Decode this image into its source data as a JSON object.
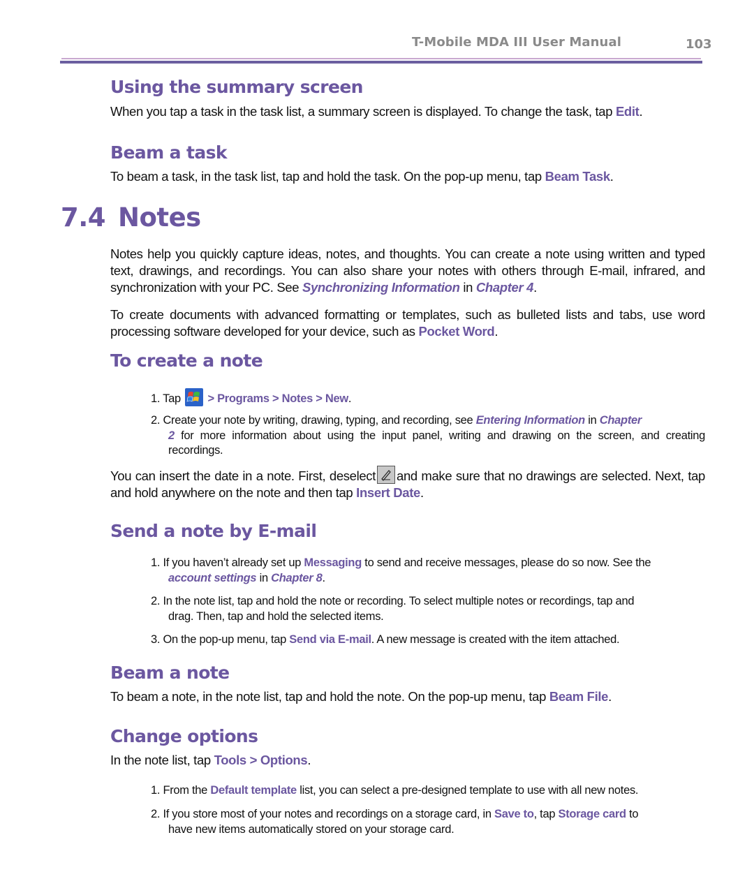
{
  "header": {
    "title": "T-Mobile MDA III User Manual",
    "page_number": "103"
  },
  "colors": {
    "accent": "#6b57a0",
    "rule_thin": "#c8a8d0",
    "rule_thick": "#6b5fa0",
    "header_text": "#8a8a8a"
  },
  "summary": {
    "heading": "Using the summary screen",
    "text_before": "When you tap a task in the task list, a summary screen is displayed. To change the task, tap ",
    "link": "Edit",
    "text_after": "."
  },
  "beam_task": {
    "heading": "Beam a task",
    "text_before": "To beam a task, in the task list, tap and hold the task. On the pop-up menu, tap ",
    "link": "Beam Task",
    "text_after": "."
  },
  "section": {
    "number": "7.4",
    "title": "Notes"
  },
  "intro": {
    "p1_text": "Notes help you quickly capture ideas, notes, and thoughts. You can create a note using written and typed text, drawings, and recordings. You can also share your notes with others through E-mail, infrared, and synchronization with your PC. See ",
    "p1_link1": "Synchronizing Information",
    "p1_mid": " in ",
    "p1_link2": "Chapter 4",
    "p1_end": ".",
    "p2_text": "To create documents with advanced formatting or templates, such as bulleted lists and tabs, use word processing software developed for your device, such as ",
    "p2_link": "Pocket Word",
    "p2_end": "."
  },
  "create_note": {
    "heading": "To create a note",
    "step1_prefix": "1. Tap",
    "step1_icon": "windows-start-icon",
    "step1_path": "> Programs > Notes > New",
    "step1_end": ".",
    "step2_text": "2. Create your note by writing, drawing, typing, and recording, see ",
    "step2_link1": "Entering Information",
    "step2_mid": " in ",
    "step2_link2a": "Chapter",
    "step2_link2b": "2",
    "step2_rest": " for more information about using the input panel, writing and drawing on the screen, and creating recordings.",
    "date_text1": "You can insert the date in a note. First, deselect",
    "date_icon": "pen-icon",
    "date_text2": "and make sure that no drawings are selected. Next, tap and hold anywhere on the note and then tap ",
    "date_link": "Insert Date",
    "date_end": "."
  },
  "send_email": {
    "heading": "Send a note by E-mail",
    "step1_text": "1. If you haven’t already set up ",
    "step1_link1": "Messaging",
    "step1_mid": " to send and receive messages, please do so now. See the",
    "step1_link2": "account settings",
    "step1_mid2": " in ",
    "step1_link3": "Chapter 8",
    "step1_end": ".",
    "step2_line1": "2. In the note list, tap and hold the note or recording. To select multiple notes or recordings, tap and",
    "step2_line2": "drag. Then, tap and hold the selected items.",
    "step3_text": "3. On the pop-up menu, tap ",
    "step3_link": "Send via E-mail",
    "step3_rest": ". A new message is created with the item attached."
  },
  "beam_note": {
    "heading": "Beam a note",
    "text_before": "To beam a note, in the note list, tap and hold the note. On the pop-up menu, tap ",
    "link": "Beam File",
    "text_after": "."
  },
  "change_options": {
    "heading": "Change options",
    "intro_text": "In the note list, tap ",
    "intro_link1": "Tools",
    "intro_sep": " > ",
    "intro_link2": "Options",
    "intro_end": ".",
    "step1_text": "1. From the ",
    "step1_link": "Default template",
    "step1_rest": " list, you can select a pre-designed template to use with all new notes.",
    "step2_text": "2. If you store most of your notes and recordings on a storage card, in ",
    "step2_link1": "Save to",
    "step2_mid": ", tap ",
    "step2_link2": "Storage card",
    "step2_rest1": " to",
    "step2_rest2": "have new items automatically stored on your storage card."
  }
}
